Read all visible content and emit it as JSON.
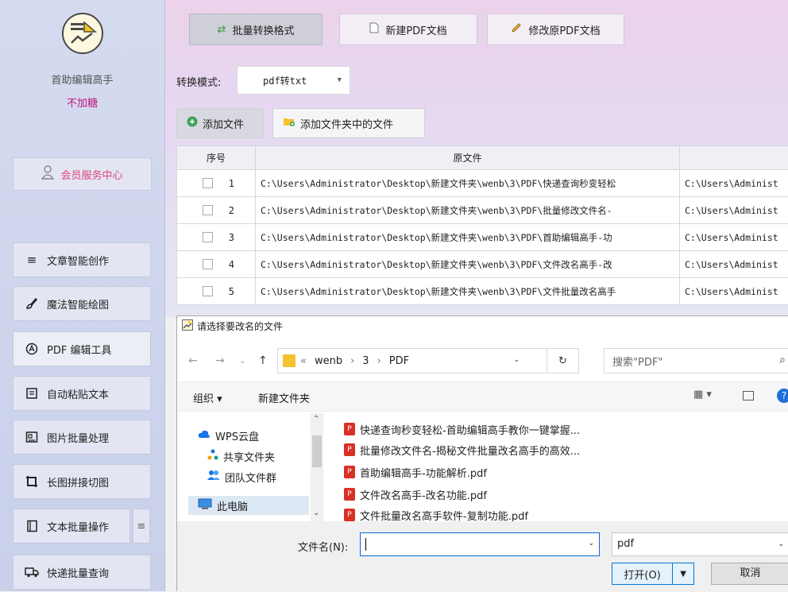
{
  "sidebar": {
    "app_name": "首助编辑高手",
    "slogan": "不加糖",
    "member_label": "会员服务中心",
    "items": [
      {
        "label": "文章智能创作",
        "icon": "menu-lines-icon"
      },
      {
        "label": "魔法智能绘图",
        "icon": "brush-icon"
      },
      {
        "label": "PDF 编辑工具",
        "icon": "pdf-tool-icon"
      },
      {
        "label": "自动粘贴文本",
        "icon": "paste-icon"
      },
      {
        "label": "图片批量处理",
        "icon": "image-icon"
      },
      {
        "label": "长图拼接切图",
        "icon": "crop-icon"
      },
      {
        "label": "文本批量操作",
        "icon": "text-doc-icon"
      },
      {
        "label": "快递批量查询",
        "icon": "truck-icon"
      }
    ]
  },
  "tabs": [
    {
      "label": "批量转换格式"
    },
    {
      "label": "新建PDF文档"
    },
    {
      "label": "修改原PDF文档"
    }
  ],
  "mode": {
    "label": "转换模式:",
    "value": "pdf转txt"
  },
  "add_buttons": {
    "add_file": "添加文件",
    "add_folder": "添加文件夹中的文件"
  },
  "table": {
    "headers": [
      "序号",
      "原文件",
      ""
    ],
    "rows": [
      {
        "idx": "1",
        "path": "C:\\Users\\Administrator\\Desktop\\新建文件夹\\wenb\\3\\PDF\\快递查询秒变轻松",
        "out": "C:\\Users\\Administ"
      },
      {
        "idx": "2",
        "path": "C:\\Users\\Administrator\\Desktop\\新建文件夹\\wenb\\3\\PDF\\批量修改文件名-",
        "out": "C:\\Users\\Administ"
      },
      {
        "idx": "3",
        "path": "C:\\Users\\Administrator\\Desktop\\新建文件夹\\wenb\\3\\PDF\\首助编辑高手-功",
        "out": "C:\\Users\\Administ"
      },
      {
        "idx": "4",
        "path": "C:\\Users\\Administrator\\Desktop\\新建文件夹\\wenb\\3\\PDF\\文件改名高手-改",
        "out": "C:\\Users\\Administ"
      },
      {
        "idx": "5",
        "path": "C:\\Users\\Administrator\\Desktop\\新建文件夹\\wenb\\3\\PDF\\文件批量改名高手",
        "out": "C:\\Users\\Administ"
      }
    ]
  },
  "dialog": {
    "title": "请选择要改名的文件",
    "address": {
      "prefix": "«",
      "parts": [
        "wenb",
        "3",
        "PDF"
      ]
    },
    "search_placeholder": "搜索\"PDF\"",
    "toolbar": {
      "organize": "组织 ▾",
      "new_folder": "新建文件夹"
    },
    "tree": [
      {
        "label": "WPS云盘",
        "icon": "cloud-icon"
      },
      {
        "label": "共享文件夹",
        "icon": "share-icon"
      },
      {
        "label": "团队文件群",
        "icon": "team-icon"
      },
      {
        "label": "此电脑",
        "icon": "computer-icon"
      }
    ],
    "files": [
      "快递查询秒变轻松-首助编辑高手教你一键掌握...",
      "批量修改文件名-揭秘文件批量改名高手的高效...",
      "首助编辑高手-功能解析.pdf",
      "文件改名高手-改名功能.pdf",
      "文件批量改名高手软件-复制功能.pdf"
    ],
    "filename_label": "文件名(N):",
    "filename_value": "",
    "filetype": "pdf",
    "open_label": "打开(O)",
    "cancel_label": "取消"
  },
  "colors": {
    "slogan": "#c0187c",
    "member": "#e0457b",
    "accent": "#0078d7"
  }
}
